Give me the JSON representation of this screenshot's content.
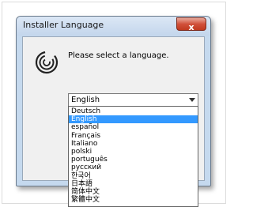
{
  "window": {
    "title": "Installer Language",
    "close_glyph": "x"
  },
  "dialog": {
    "prompt": "Please select a language.",
    "icon": "installer-logo-icon",
    "selected_value": "English"
  },
  "languages": [
    "Deutsch",
    "English",
    "español",
    "Français",
    "Italiano",
    "polski",
    "português",
    "русский",
    "한국어",
    "日本語",
    "简体中文",
    "繁體中文"
  ],
  "highlighted_index": 1,
  "colors": {
    "highlight": "#3399ff",
    "titlebar": "#c4d6ec",
    "close_button": "#c0391f"
  }
}
